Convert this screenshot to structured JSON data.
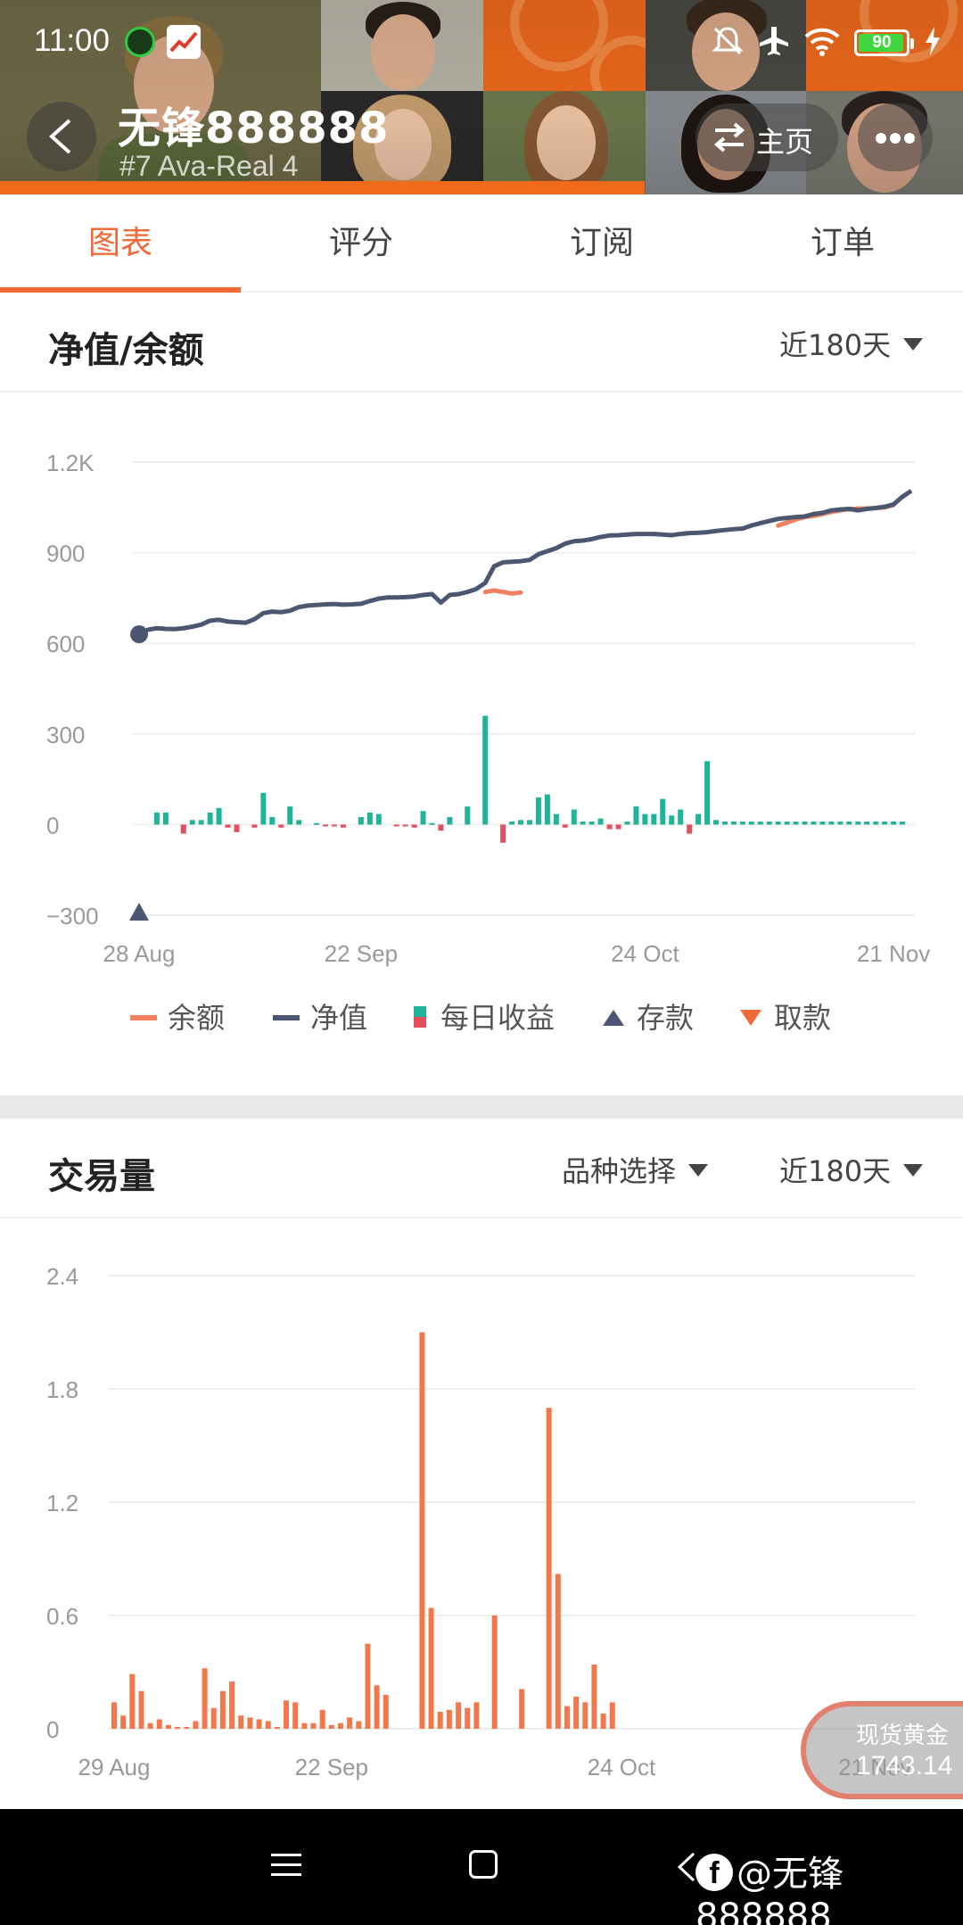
{
  "status_bar": {
    "time": "11:00",
    "battery": "90",
    "icons": [
      "status-app-icon",
      "trading-app-icon",
      "mute-bell-icon",
      "airplane-icon",
      "wifi-icon",
      "battery-icon",
      "charging-icon"
    ]
  },
  "header": {
    "user_name": "无锋888888",
    "subtitle": "#7  Ava-Real 4",
    "home_label": "主页"
  },
  "tabs": [
    {
      "label": "图表",
      "active": true
    },
    {
      "label": "评分",
      "active": false
    },
    {
      "label": "订阅",
      "active": false
    },
    {
      "label": "订单",
      "active": false
    }
  ],
  "equity_section": {
    "title": "净值/余额",
    "period": "近180天"
  },
  "volume_section": {
    "title": "交易量",
    "symbol_select": "品种选择",
    "period": "近180天"
  },
  "legend": {
    "balance": "余额",
    "equity": "净值",
    "daily": "每日收益",
    "deposit": "存款",
    "withdraw": "取款"
  },
  "colors": {
    "accent": "#f06a36",
    "equity_line": "#4b5670",
    "balance_line": "#f08060",
    "profit_bar": "#1fb497",
    "loss_bar": "#e0505f",
    "volume_bar": "#f2784b",
    "grid": "#eeeeee"
  },
  "gold_widget": {
    "name": "现货黄金",
    "price": "1743.14"
  },
  "watermark": "@无锋888888",
  "chart_data": [
    {
      "type": "line",
      "title": "净值/余额",
      "ylim": [
        -300,
        1200
      ],
      "yticks": [
        "1.2K",
        "900",
        "600",
        "300",
        "0",
        "−300"
      ],
      "ytick_values": [
        1200,
        900,
        600,
        300,
        0,
        -300
      ],
      "xticks": [
        "28 Aug",
        "22 Sep",
        "24 Oct",
        "21 Nov"
      ],
      "xtick_days": [
        0,
        25,
        57,
        85
      ],
      "xrange_days": [
        0,
        87
      ],
      "legend_position": "bottom",
      "grid": true,
      "series": [
        {
          "name": "净值",
          "x": [
            0,
            1,
            2,
            3,
            4,
            5,
            6,
            7,
            8,
            9,
            10,
            11,
            12,
            13,
            14,
            15,
            16,
            17,
            18,
            19,
            20,
            21,
            22,
            23,
            24,
            25,
            26,
            27,
            28,
            29,
            30,
            31,
            32,
            33,
            34,
            35,
            36,
            37,
            38,
            39,
            40,
            41,
            42,
            43,
            44,
            45,
            46,
            47,
            48,
            49,
            50,
            51,
            52,
            53,
            54,
            55,
            56,
            57,
            58,
            59,
            60,
            61,
            62,
            63,
            64,
            65,
            66,
            67,
            68,
            69,
            70,
            71,
            72,
            73,
            74,
            75,
            76,
            77,
            78,
            79,
            80,
            81,
            82,
            83,
            84,
            85,
            86,
            87
          ],
          "values": [
            630,
            645,
            650,
            648,
            647,
            650,
            655,
            662,
            675,
            678,
            672,
            670,
            668,
            680,
            700,
            705,
            703,
            708,
            720,
            725,
            727,
            729,
            730,
            728,
            729,
            731,
            740,
            748,
            752,
            752,
            753,
            755,
            760,
            763,
            735,
            760,
            763,
            770,
            780,
            800,
            855,
            868,
            870,
            872,
            876,
            895,
            905,
            915,
            930,
            938,
            940,
            945,
            952,
            957,
            958,
            960,
            962,
            962,
            962,
            960,
            958,
            962,
            965,
            966,
            968,
            972,
            975,
            978,
            980,
            990,
            998,
            1005,
            1012,
            1015,
            1018,
            1020,
            1028,
            1032,
            1040,
            1043,
            1045,
            1040,
            1045,
            1048,
            1052,
            1060,
            1085,
            1105
          ]
        },
        {
          "name": "余额",
          "x": [
            39,
            40,
            41,
            42,
            43,
            72,
            73,
            74,
            75,
            76,
            77,
            78,
            79,
            80,
            81,
            82,
            83,
            84,
            85
          ],
          "values": [
            770,
            775,
            770,
            765,
            768,
            990,
            1000,
            1010,
            1018,
            1022,
            1028,
            1035,
            1040,
            1044,
            1046,
            1046,
            1048,
            1050,
            1058
          ]
        },
        {
          "name": "每日收益",
          "type": "bar",
          "x": [
            2,
            3,
            5,
            6,
            7,
            8,
            9,
            10,
            11,
            13,
            14,
            15,
            16,
            17,
            18,
            20,
            21,
            22,
            23,
            25,
            26,
            27,
            29,
            30,
            31,
            32,
            33,
            34,
            35,
            37,
            39,
            41,
            42,
            43,
            44,
            45,
            46,
            47,
            48,
            49,
            50,
            51,
            52,
            53,
            54,
            55,
            56,
            57,
            58,
            59,
            60,
            61,
            62,
            63,
            64,
            65,
            66,
            67,
            68,
            69,
            70,
            71,
            72,
            73,
            74,
            75,
            76,
            77,
            78,
            79,
            80,
            81,
            82,
            83,
            84,
            85,
            86
          ],
          "values": [
            40,
            40,
            -30,
            15,
            15,
            40,
            55,
            -10,
            -25,
            -10,
            105,
            25,
            -10,
            60,
            15,
            5,
            -5,
            -5,
            -10,
            25,
            40,
            35,
            -5,
            -5,
            -10,
            45,
            5,
            -20,
            25,
            60,
            360,
            -60,
            10,
            15,
            15,
            90,
            100,
            35,
            -10,
            50,
            10,
            10,
            20,
            -15,
            -15,
            10,
            60,
            35,
            35,
            85,
            30,
            50,
            -30,
            35,
            210,
            15,
            10,
            10,
            10,
            10,
            10,
            10,
            10,
            10,
            10,
            10,
            10,
            10,
            10,
            10,
            10,
            10,
            10,
            10,
            10,
            10,
            10
          ]
        },
        {
          "name": "存款",
          "type": "marker",
          "x": [
            0
          ],
          "values": [
            -300
          ]
        },
        {
          "name": "取款",
          "type": "marker",
          "x": [],
          "values": []
        }
      ]
    },
    {
      "type": "bar",
      "title": "交易量",
      "ylim": [
        0,
        2.4
      ],
      "yticks": [
        "2.4",
        "1.8",
        "1.2",
        "0.6",
        "0"
      ],
      "ytick_values": [
        2.4,
        1.8,
        1.2,
        0.6,
        0
      ],
      "xticks": [
        "29 Aug",
        "22 Sep",
        "24 Oct",
        "21 Nov"
      ],
      "xtick_days": [
        0,
        24,
        56,
        84
      ],
      "xrange_days": [
        0,
        88
      ],
      "grid": true,
      "series": [
        {
          "name": "交易量",
          "x": [
            0,
            1,
            2,
            3,
            4,
            5,
            6,
            7,
            8,
            9,
            10,
            11,
            12,
            13,
            14,
            15,
            16,
            17,
            18,
            19,
            20,
            21,
            22,
            23,
            24,
            25,
            26,
            27,
            28,
            29,
            30,
            31,
            32,
            33,
            34,
            35,
            36,
            37,
            38,
            39,
            40,
            41,
            42,
            43,
            44,
            45,
            46,
            47,
            48,
            49,
            50,
            51,
            52,
            53,
            54,
            55,
            56,
            57,
            58,
            59,
            60,
            61,
            62,
            63,
            64,
            65,
            66,
            67,
            68,
            69,
            70,
            71,
            72,
            73,
            74,
            75,
            76,
            77,
            78,
            79,
            80,
            81,
            82,
            83,
            84,
            85,
            86,
            87,
            88
          ],
          "values": [
            0.14,
            0.07,
            0.29,
            0.2,
            0.03,
            0.05,
            0.02,
            0.01,
            0.01,
            0.04,
            0.32,
            0.11,
            0.2,
            0.25,
            0.07,
            0.06,
            0.05,
            0.04,
            0.01,
            0.15,
            0.14,
            0.03,
            0.03,
            0.1,
            0.02,
            0.03,
            0.06,
            0.04,
            0.45,
            0.23,
            0.18,
            0.0,
            0.0,
            0.0,
            2.1,
            0.64,
            0.09,
            0.1,
            0.14,
            0.11,
            0.14,
            0.0,
            0.6,
            0.0,
            0.0,
            0.21,
            0.0,
            0.0,
            1.7,
            0.82,
            0.12,
            0.17,
            0.14,
            0.34,
            0.08,
            0.14,
            0.0,
            0.0,
            0.0,
            0.0,
            0.0,
            0.0,
            0.0,
            0.0,
            0.0,
            0.0,
            0.0,
            0.0,
            0.0,
            0.0,
            0.0,
            0.0,
            0.0,
            0.0,
            0.0,
            0.0,
            0.0,
            0.0,
            0.0,
            0.0,
            0.0,
            0.0,
            0.0,
            0.0,
            0.0,
            0.0,
            0.0,
            0.0,
            0.0
          ]
        }
      ]
    }
  ]
}
